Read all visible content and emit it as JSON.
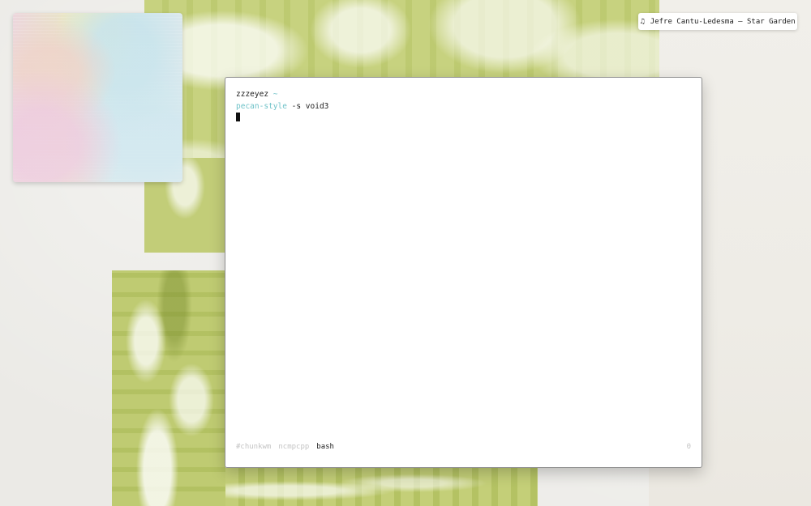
{
  "now_playing": {
    "icon": "music-note-icon",
    "track": "Jefre Cantu-Ledesma – Star Garden"
  },
  "terminal": {
    "prompt": {
      "user": "zzzeyez",
      "cwd": "~"
    },
    "command": {
      "name": "pecan-style",
      "args": " -s void3"
    },
    "tmux": {
      "windows": [
        {
          "label": "#chunkwm",
          "active": false
        },
        {
          "label": "ncmpcpp",
          "active": false
        },
        {
          "label": "bash",
          "active": true
        }
      ],
      "right_status": "0"
    }
  },
  "colors": {
    "accent_cyan": "#6fc2c8",
    "inactive_tab": "#c4c4c4",
    "wallpaper_green": "#c7d27f"
  }
}
